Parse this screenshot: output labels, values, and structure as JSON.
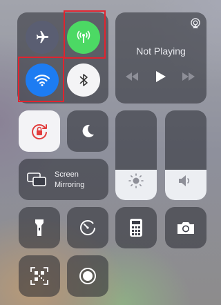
{
  "connectivity": {
    "airplane": {
      "label": "Airplane Mode",
      "state": "off",
      "icon": "airplane-icon"
    },
    "cellular": {
      "label": "Cellular Data",
      "state": "on",
      "color": "#4cd964",
      "icon": "antenna-icon"
    },
    "wifi": {
      "label": "Wi-Fi",
      "state": "on",
      "color": "#1d7cf2",
      "icon": "wifi-icon"
    },
    "bluetooth": {
      "label": "Bluetooth",
      "state": "off",
      "icon": "bluetooth-icon"
    }
  },
  "now_playing": {
    "title": "Not Playing",
    "airplay_icon": "airplay-icon"
  },
  "screen_mirroring": {
    "line1": "Screen",
    "line2": "Mirroring"
  },
  "brightness": {
    "level": 0.34,
    "icon": "sun-icon"
  },
  "volume": {
    "level": 0.34,
    "icon": "speaker-icon"
  },
  "highlight_color": "#e0242f"
}
